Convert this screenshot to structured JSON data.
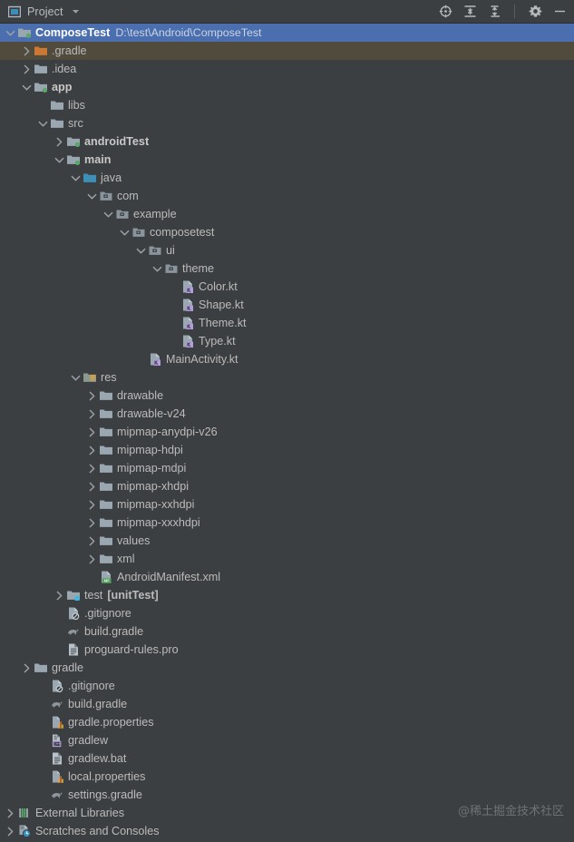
{
  "header": {
    "title": "Project",
    "icon": "project-window-icon",
    "dropdown_icon": "chevron-down-icon",
    "actions": [
      {
        "name": "select-opened-file-icon",
        "title": "Select Opened File"
      },
      {
        "name": "expand-all-icon",
        "title": "Expand All"
      },
      {
        "name": "collapse-all-icon",
        "title": "Collapse All"
      },
      {
        "name": "settings-gear-icon",
        "title": "Settings"
      },
      {
        "name": "hide-icon",
        "title": "Hide"
      }
    ]
  },
  "watermark": "@稀土掘金技术社区",
  "colors": {
    "background": "#3c3f41",
    "selection": "#4b6eaf",
    "hover": "#514b3e",
    "text": "#bbbbbb",
    "secondary_text": "#8e9194",
    "folder_gray": "#9aa7b0",
    "folder_orange": "#cc7832",
    "folder_source": "#3d8fb8",
    "module_dot": "#59a869",
    "kotlin_badge": "#b39ddb"
  },
  "tree": [
    {
      "depth": 0,
      "arrow": "down",
      "icon": "folder-module-icon",
      "label": "ComposeTest",
      "sublabel": "D:\\test\\Android\\ComposeTest",
      "state": "selected"
    },
    {
      "depth": 1,
      "arrow": "right",
      "icon": "folder-orange-icon",
      "label": ".gradle",
      "state": "hovered"
    },
    {
      "depth": 1,
      "arrow": "right",
      "icon": "folder-icon",
      "label": ".idea"
    },
    {
      "depth": 1,
      "arrow": "down",
      "icon": "folder-module-icon",
      "label": "app",
      "bold": true
    },
    {
      "depth": 2,
      "arrow": "none",
      "icon": "folder-icon",
      "label": "libs"
    },
    {
      "depth": 2,
      "arrow": "down",
      "icon": "folder-icon",
      "label": "src"
    },
    {
      "depth": 3,
      "arrow": "right",
      "icon": "folder-module-icon",
      "label": "androidTest",
      "bold": true
    },
    {
      "depth": 3,
      "arrow": "down",
      "icon": "folder-module-icon",
      "label": "main",
      "bold": true
    },
    {
      "depth": 4,
      "arrow": "down",
      "icon": "folder-source-icon",
      "label": "java"
    },
    {
      "depth": 5,
      "arrow": "down",
      "icon": "package-icon",
      "label": "com"
    },
    {
      "depth": 6,
      "arrow": "down",
      "icon": "package-icon",
      "label": "example"
    },
    {
      "depth": 7,
      "arrow": "down",
      "icon": "package-icon",
      "label": "composetest"
    },
    {
      "depth": 8,
      "arrow": "down",
      "icon": "package-icon",
      "label": "ui"
    },
    {
      "depth": 9,
      "arrow": "down",
      "icon": "package-icon",
      "label": "theme"
    },
    {
      "depth": 10,
      "arrow": "none",
      "icon": "kotlin-file-icon",
      "label": "Color.kt"
    },
    {
      "depth": 10,
      "arrow": "none",
      "icon": "kotlin-file-icon",
      "label": "Shape.kt"
    },
    {
      "depth": 10,
      "arrow": "none",
      "icon": "kotlin-file-icon",
      "label": "Theme.kt"
    },
    {
      "depth": 10,
      "arrow": "none",
      "icon": "kotlin-file-icon",
      "label": "Type.kt"
    },
    {
      "depth": 8,
      "arrow": "none",
      "icon": "kotlin-class-icon",
      "label": "MainActivity.kt"
    },
    {
      "depth": 4,
      "arrow": "down",
      "icon": "folder-res-icon",
      "label": "res"
    },
    {
      "depth": 5,
      "arrow": "right",
      "icon": "folder-icon",
      "label": "drawable"
    },
    {
      "depth": 5,
      "arrow": "right",
      "icon": "folder-icon",
      "label": "drawable-v24"
    },
    {
      "depth": 5,
      "arrow": "right",
      "icon": "folder-icon",
      "label": "mipmap-anydpi-v26"
    },
    {
      "depth": 5,
      "arrow": "right",
      "icon": "folder-icon",
      "label": "mipmap-hdpi"
    },
    {
      "depth": 5,
      "arrow": "right",
      "icon": "folder-icon",
      "label": "mipmap-mdpi"
    },
    {
      "depth": 5,
      "arrow": "right",
      "icon": "folder-icon",
      "label": "mipmap-xhdpi"
    },
    {
      "depth": 5,
      "arrow": "right",
      "icon": "folder-icon",
      "label": "mipmap-xxhdpi"
    },
    {
      "depth": 5,
      "arrow": "right",
      "icon": "folder-icon",
      "label": "mipmap-xxxhdpi"
    },
    {
      "depth": 5,
      "arrow": "right",
      "icon": "folder-icon",
      "label": "values"
    },
    {
      "depth": 5,
      "arrow": "right",
      "icon": "folder-icon",
      "label": "xml"
    },
    {
      "depth": 5,
      "arrow": "none",
      "icon": "manifest-file-icon",
      "label": "AndroidManifest.xml"
    },
    {
      "depth": 3,
      "arrow": "right",
      "icon": "folder-test-icon",
      "label": "test",
      "suffix": "[unitTest]"
    },
    {
      "depth": 3,
      "arrow": "none",
      "icon": "gitignore-file-icon",
      "label": ".gitignore"
    },
    {
      "depth": 3,
      "arrow": "none",
      "icon": "gradle-file-icon",
      "label": "build.gradle"
    },
    {
      "depth": 3,
      "arrow": "none",
      "icon": "text-file-icon",
      "label": "proguard-rules.pro"
    },
    {
      "depth": 1,
      "arrow": "right",
      "icon": "folder-icon",
      "label": "gradle"
    },
    {
      "depth": 2,
      "arrow": "none",
      "icon": "gitignore-file-icon",
      "label": ".gitignore"
    },
    {
      "depth": 2,
      "arrow": "none",
      "icon": "gradle-file-icon",
      "label": "build.gradle"
    },
    {
      "depth": 2,
      "arrow": "none",
      "icon": "properties-file-icon",
      "label": "gradle.properties"
    },
    {
      "depth": 2,
      "arrow": "none",
      "icon": "cpp-file-icon",
      "label": "gradlew"
    },
    {
      "depth": 2,
      "arrow": "none",
      "icon": "text-file-icon",
      "label": "gradlew.bat"
    },
    {
      "depth": 2,
      "arrow": "none",
      "icon": "properties-file-icon",
      "label": "local.properties"
    },
    {
      "depth": 2,
      "arrow": "none",
      "icon": "gradle-file-icon",
      "label": "settings.gradle"
    },
    {
      "depth": 0,
      "arrow": "right",
      "icon": "external-libraries-icon",
      "label": "External Libraries"
    },
    {
      "depth": 0,
      "arrow": "right",
      "icon": "scratches-icon",
      "label": "Scratches and Consoles"
    }
  ]
}
